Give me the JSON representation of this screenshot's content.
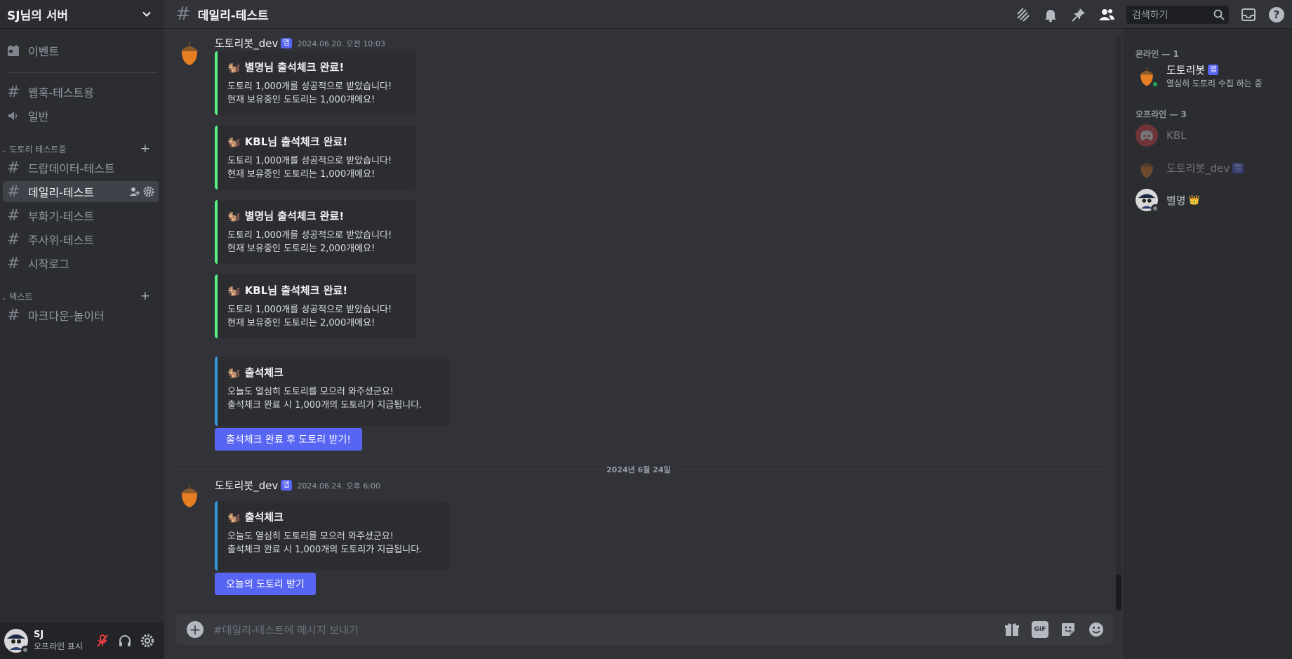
{
  "server": {
    "name": "SJ님의 서버"
  },
  "sidebar": {
    "events_label": "이벤트",
    "channels_top": [
      {
        "label": "웹훅-테스트용",
        "type": "text"
      },
      {
        "label": "일반",
        "type": "voice"
      }
    ],
    "category1": {
      "label": "도토리 테스트중",
      "channels": [
        {
          "label": "드랍데이터-테스트"
        },
        {
          "label": "데일리-테스트",
          "active": true
        },
        {
          "label": "부화기-테스트"
        },
        {
          "label": "주사위-테스트"
        },
        {
          "label": "시작로그"
        }
      ]
    },
    "category2": {
      "label": "텍스트",
      "channels": [
        {
          "label": "마크다운-놀이터"
        }
      ]
    }
  },
  "user_panel": {
    "name": "SJ",
    "status": "오프라인 표시"
  },
  "topbar": {
    "channel": "데일리-테스트",
    "search_placeholder": "검색하기"
  },
  "messages": [
    {
      "author": "도토리봇_dev",
      "badge": "앱",
      "timestamp": "2024.06.20. 오전 10:03",
      "embeds": [
        {
          "title": "별명님 출석체크 완료!",
          "desc": "도토리 1,000개를 성공적으로 받았습니다!\n현재 보유중인 도토리는 1,000개에요!"
        },
        {
          "title": "KBL님 출석체크 완료!",
          "desc": "도토리 1,000개를 성공적으로 받았습니다!\n현재 보유중인 도토리는 1,000개에요!"
        },
        {
          "title": "별명님 출석체크 완료!",
          "desc": "도토리 1,000개를 성공적으로 받았습니다!\n현재 보유중인 도토리는 2,000개에요!"
        },
        {
          "title": "KBL님 출석체크 완료!",
          "desc": "도토리 1,000개를 성공적으로 받았습니다!\n현재 보유중인 도토리는 2,000개에요!"
        },
        {
          "title": "출석체크",
          "desc": "오늘도 열심히 도토리를 모으러 와주셨군요!\n출석체크 완료 시 1,000개의 도토리가 지급됩니다."
        }
      ],
      "button": "출석체크 완료 후 도토리 받기!"
    },
    {
      "author": "도토리봇_dev",
      "badge": "앱",
      "timestamp": "2024.06.24. 오후 6:00",
      "embeds": [
        {
          "title": "출석체크",
          "desc": "오늘도 열심히 도토리를 모으러 와주셨군요!\n출석체크 완료 시 1,000개의 도토리가 지급됩니다."
        }
      ],
      "button": "오늘의 도토리 받기"
    }
  ],
  "date_divider": "2024년 6월 24일",
  "composer": {
    "placeholder": "#데일리-테스트에 메시지 보내기",
    "gif_label": "GIF"
  },
  "members": {
    "online_header": "온라인 — 1",
    "offline_header": "오프라인 — 3",
    "online": [
      {
        "name": "도토리봇",
        "badge": "앱",
        "activity": "열심히 도토리 수집 하는 중"
      }
    ],
    "offline": [
      {
        "name": "KBL"
      },
      {
        "name": "도토리봇_dev",
        "badge": "앱"
      },
      {
        "name": "별명",
        "crown": "👑"
      }
    ]
  },
  "colors": {
    "accent": "#5865f2",
    "embed_green": "#57f287",
    "embed_blue": "#3498db",
    "online": "#23a55a"
  }
}
